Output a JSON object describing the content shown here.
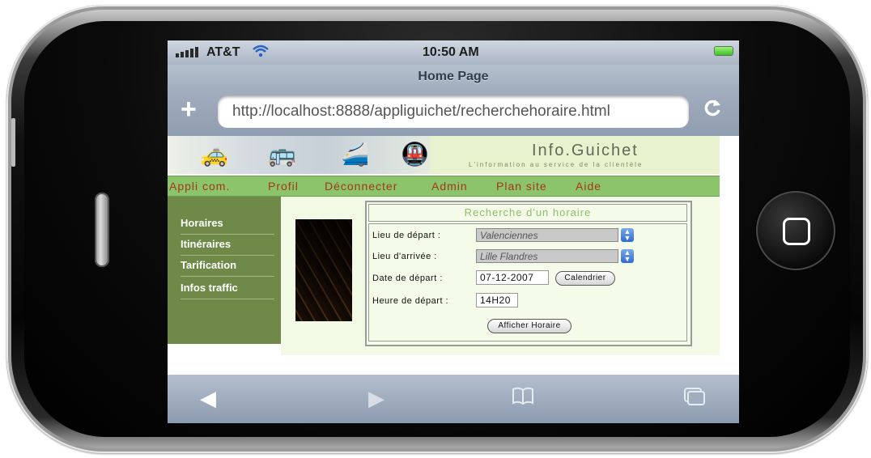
{
  "status": {
    "carrier": "AT&T",
    "time": "10:50 AM"
  },
  "browser": {
    "page_title": "Home Page",
    "url": "http://localhost:8888/appliguichet/recherchehoraire.html"
  },
  "site": {
    "brand": "Info.Guichet",
    "tagline": "L'information au service de la clientèle",
    "menu": [
      "Appli com.",
      "Profil",
      "Déconnecter",
      "Admin",
      "Plan site",
      "Aide"
    ],
    "sidebar": [
      "Horaires",
      "Itinéraires",
      "Tarification",
      "Infos traffic"
    ]
  },
  "form": {
    "title": "Recherche d'un horaire",
    "depart_label": "Lieu de départ :",
    "depart_value": "Valenciennes",
    "arrivee_label": "Lieu d'arrivée :",
    "arrivee_value": "Lille Flandres",
    "date_label": "Date de départ :",
    "date_value": "07-12-2007",
    "calendar_button": "Calendrier",
    "heure_label": "Heure de départ :",
    "heure_value": "14H20",
    "submit_button": "Afficher Horaire"
  },
  "icons": {
    "status": [
      "signal-icon",
      "wifi-icon",
      "battery-icon"
    ],
    "browser": [
      "add-bookmark-icon",
      "reload-icon"
    ],
    "toolbar": [
      "back-icon",
      "forward-icon",
      "bookmarks-icon",
      "pages-icon"
    ]
  }
}
